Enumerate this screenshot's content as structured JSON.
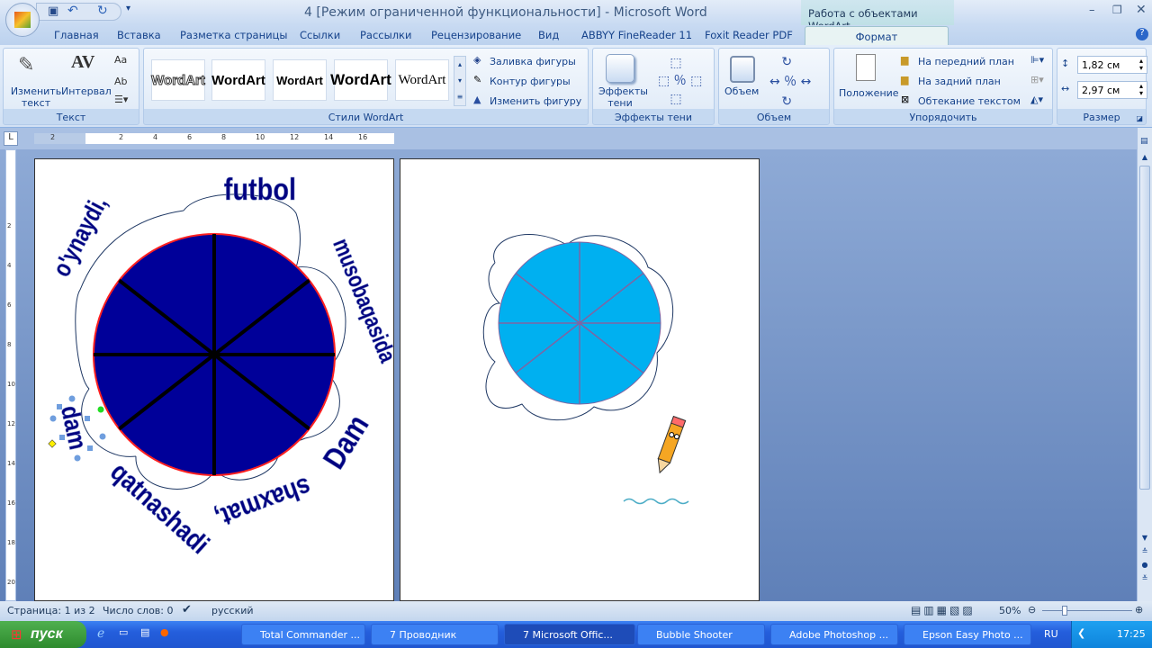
{
  "window": {
    "title": "4 [Режим ограниченной функциональности] - Microsoft Word",
    "context_tab_group": "Работа с объектами WordArt"
  },
  "tabs": [
    "Главная",
    "Вставка",
    "Разметка страницы",
    "Ссылки",
    "Рассылки",
    "Рецензирование",
    "Вид",
    "ABBYY FineReader 11",
    "Foxit Reader PDF"
  ],
  "active_tab": "Формат",
  "ribbon": {
    "text_group": {
      "label": "Текст",
      "edit_text": "Изменить текст",
      "spacing": "Интервал"
    },
    "styles_group": {
      "label": "Стили WordArt",
      "gallery": [
        "WordArt",
        "WordArt",
        "WordArt",
        "WordArt",
        "WordArt"
      ],
      "fill": "Заливка фигуры",
      "outline": "Контур фигуры",
      "change_shape": "Изменить фигуру"
    },
    "shadow_group": {
      "label": "Эффекты тени",
      "button": "Эффекты тени"
    },
    "volume_group": {
      "label": "Объем",
      "button": "Объем"
    },
    "arrange_group": {
      "label": "Упорядочить",
      "position": "Положение",
      "bring_front": "На передний план",
      "send_back": "На задний план",
      "wrap": "Обтекание текстом"
    },
    "size_group": {
      "label": "Размер",
      "height": "1,82 см",
      "width": "2,97 см"
    }
  },
  "ruler": {
    "ticks": [
      "2",
      "",
      "2",
      "4",
      "6",
      "8",
      "10",
      "12",
      "14",
      "16"
    ]
  },
  "vruler": {
    "ticks": [
      "2",
      "4",
      "6",
      "8",
      "10",
      "12",
      "14",
      "16",
      "18",
      "20",
      "22"
    ]
  },
  "document": {
    "wordart": {
      "top": "futbol",
      "upper_left": "o'ynaydi,",
      "right": "musobaqasida",
      "lower_right": "Dam",
      "bottom": "shaxmat,",
      "lower_left": "qatnashadi",
      "left": "dam"
    },
    "colors": {
      "left_circle": "#000099",
      "right_circle": "#00b0f0",
      "wordart": "#000080"
    }
  },
  "status": {
    "page": "Страница: 1 из 2",
    "words": "Число слов: 0",
    "language": "русский",
    "zoom": "50%"
  },
  "taskbar": {
    "start": "пуск",
    "items": [
      "Total Commander ...",
      "7 Проводник",
      "7 Microsoft Offic...",
      "Bubble Shooter",
      "Adobe Photoshop ...",
      "Epson Easy Photo ..."
    ],
    "lang": "RU",
    "clock": "17:25"
  }
}
